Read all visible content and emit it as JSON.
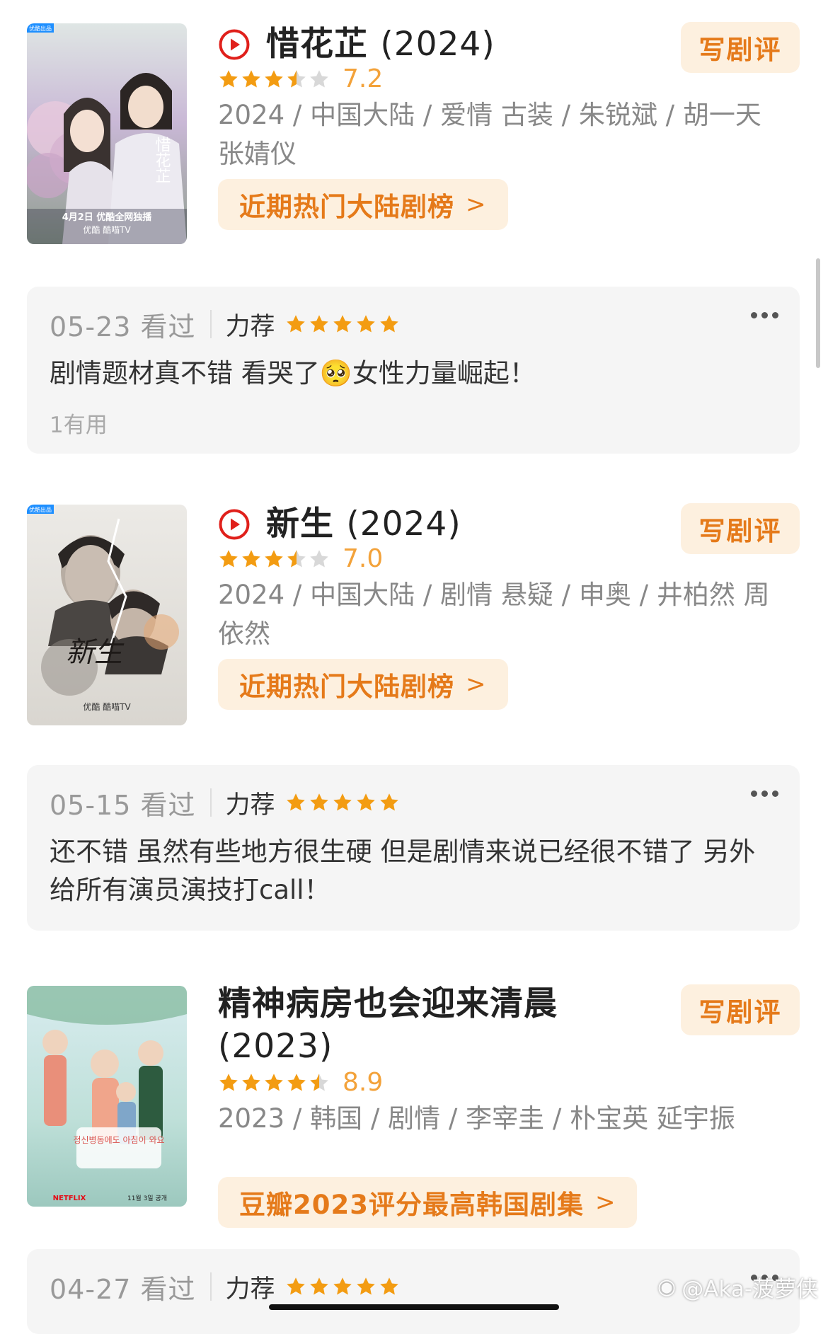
{
  "colors": {
    "accent": "#e57a1a",
    "accent_bg": "#fdf0df",
    "star": "#f39c12",
    "star_empty": "#d8d8d8",
    "play_red": "#e0201b"
  },
  "shows": [
    {
      "title": "惜花芷",
      "year": "(2024)",
      "rating": 7.2,
      "rating_text": "7.2",
      "stars_filled": 3.5,
      "meta": "2024 / 中国大陆 / 爱情 古装 / 朱锐斌 / 胡一天 张婧仪",
      "rank_label": "近期热门大陆剧榜",
      "write_label": "写剧评",
      "poster_badge": "优酷出品",
      "poster_text": "4月2日 优酷全网独播",
      "poster_brands": "优酷  酷喵TV",
      "poster_vertical": "惜花芷",
      "review": {
        "date": "05-23 看过",
        "rec_label": "力荐",
        "rec_stars": 5,
        "text": "剧情题材真不错 看哭了🥺女性力量崛起！",
        "useful": "1有用"
      }
    },
    {
      "title": "新生",
      "year": "(2024)",
      "rating": 7.0,
      "rating_text": "7.0",
      "stars_filled": 3.5,
      "meta": "2024 / 中国大陆 / 剧情 悬疑 / 申奥 / 井柏然 周依然",
      "rank_label": "近期热门大陆剧榜",
      "write_label": "写剧评",
      "poster_badge": "优酷出品",
      "poster_calligraphy": "新生",
      "poster_brands": "优酷  酷喵TV",
      "review": {
        "date": "05-15 看过",
        "rec_label": "力荐",
        "rec_stars": 5,
        "text": "还不错 虽然有些地方很生硬 但是剧情来说已经很不错了 另外给所有演员演技打call！"
      }
    },
    {
      "title": "精神病房也会迎来清晨",
      "year": "(2023)",
      "rating": 8.9,
      "rating_text": "8.9",
      "stars_filled": 4.5,
      "meta": "2023 / 韩国 / 剧情 / 李宰圭 / 朴宝英 延宇振",
      "rank_label": "豆瓣2023评分最高韩国剧集",
      "write_label": "写剧评",
      "poster_korean": "정신병동에도 아침이 와요",
      "poster_date": "11월 3일 공개",
      "poster_brand": "NETFLIX",
      "review": {
        "date": "04-27 看过",
        "rec_label": "力荐",
        "rec_stars": 5
      }
    }
  ],
  "watermark": "@Aka-菠萝侠"
}
